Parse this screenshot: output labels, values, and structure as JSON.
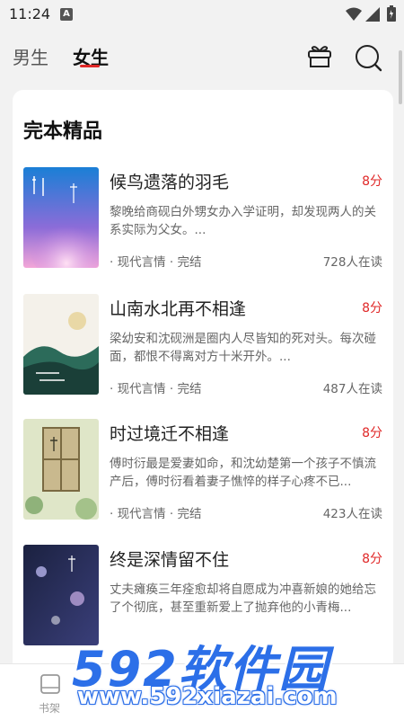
{
  "status": {
    "time": "11:24",
    "notif_letter": "A"
  },
  "tabs": {
    "male": "男生",
    "female": "女生"
  },
  "section": {
    "title": "完本精品"
  },
  "books": [
    {
      "title": "候鸟遗落的羽毛",
      "score": "8分",
      "desc": "黎晚给商砚白外甥女办入学证明，却发现两人的关系实际为父女。...",
      "tags": "· 现代言情 · 完结",
      "readers": "728人在读"
    },
    {
      "title": "山南水北再不相逢",
      "score": "8分",
      "desc": "梁幼安和沈砚洲是圈内人尽皆知的死对头。每次碰面，都恨不得离对方十米开外。...",
      "tags": "· 现代言情 · 完结",
      "readers": "487人在读"
    },
    {
      "title": "时过境迁不相逢",
      "score": "8分",
      "desc": "傅时衍最是爱妻如命，和沈幼楚第一个孩子不慎流产后，傅时衍看着妻子憔悴的样子心疼不已...",
      "tags": "· 现代言情 · 完结",
      "readers": "423人在读"
    },
    {
      "title": "终是深情留不住",
      "score": "8分",
      "desc": "丈夫瘫痪三年痊愈却将自愿成为冲喜新娘的她给忘了个彻底，甚至重新爱上了抛弃他的小青梅...",
      "tags": "",
      "readers": ""
    }
  ],
  "bottom_nav": {
    "shelf": "书架"
  },
  "watermark": {
    "line1": "592软件园",
    "line2": "www.592xiazai.com"
  },
  "colors": {
    "accent": "#e02828",
    "card": "#ffffff",
    "background": "#f2f2f2",
    "watermark": "#2c6fe8"
  }
}
